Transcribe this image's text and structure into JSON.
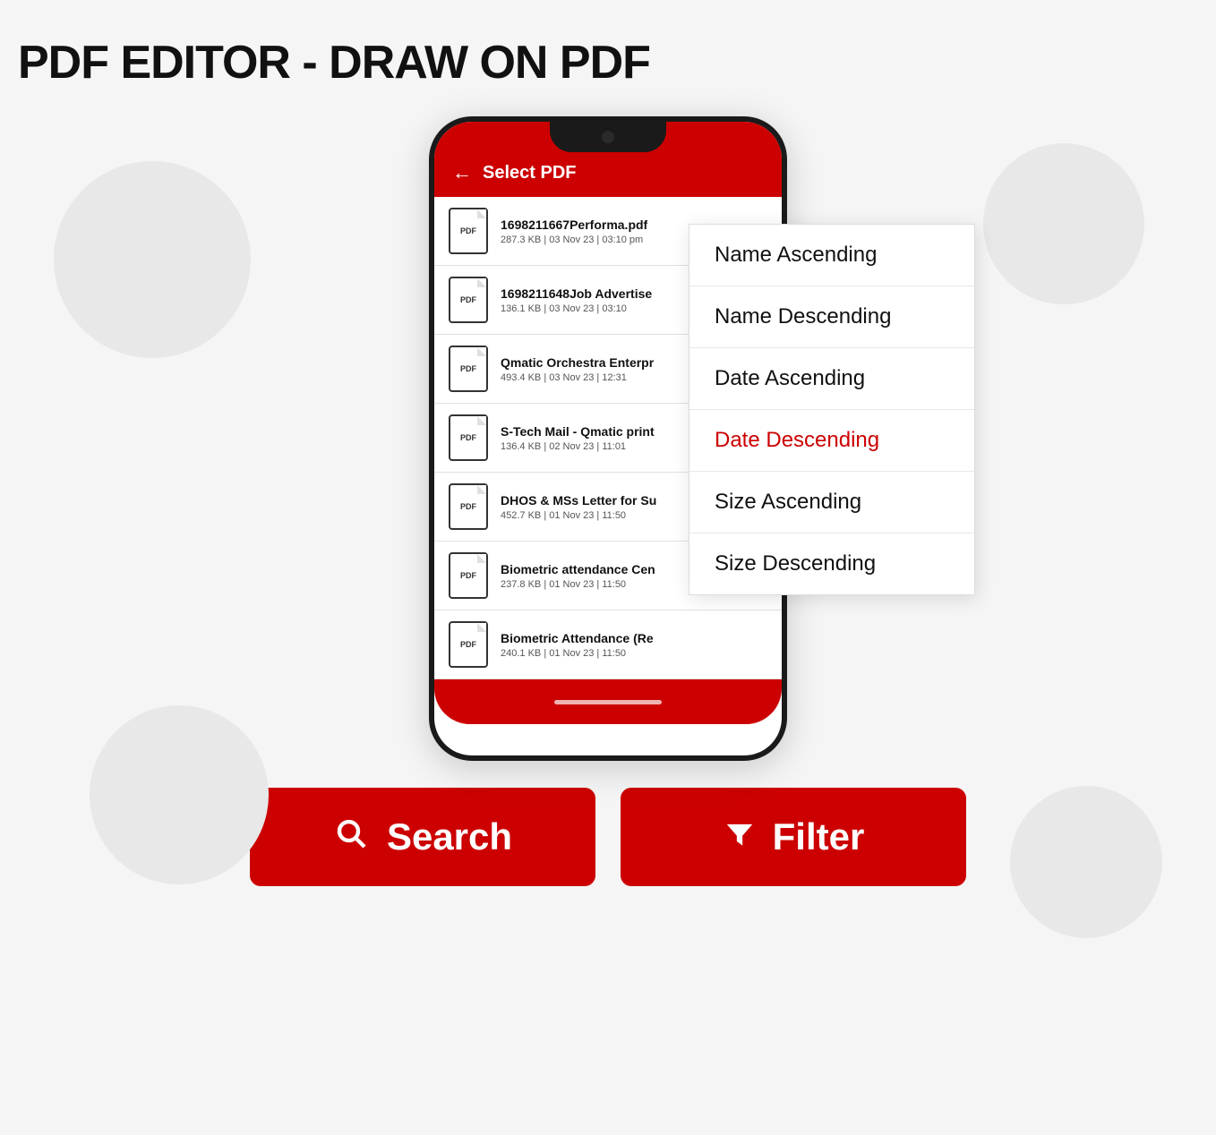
{
  "page": {
    "title": "PDF EDITOR - DRAW ON PDF",
    "bg_color": "#f5f5f5"
  },
  "phone": {
    "header": {
      "back_icon": "←",
      "title": "Select PDF"
    },
    "pdf_list": [
      {
        "name": "1698211667Performa.pdf",
        "meta": "287.3 KB  |  03 Nov 23 | 03:10 pm",
        "icon_label": "PDF"
      },
      {
        "name": "1698211648Job Advertise",
        "meta": "136.1 KB  |  03 Nov 23 | 03:10",
        "icon_label": "PDF"
      },
      {
        "name": "Qmatic Orchestra Enterpr",
        "meta": "493.4 KB  |  03 Nov 23 | 12:31",
        "icon_label": "PDF"
      },
      {
        "name": "S-Tech Mail - Qmatic print",
        "meta": "136.4 KB  |  02 Nov 23 | 11:01",
        "icon_label": "PDF"
      },
      {
        "name": "DHOS & MSs Letter for Su",
        "meta": "452.7 KB  |  01 Nov 23 | 11:50",
        "icon_label": "PDF"
      },
      {
        "name": "Biometric attendance Cen",
        "meta": "237.8 KB  |  01 Nov 23 | 11:50",
        "icon_label": "PDF"
      },
      {
        "name": "Biometric Attendance (Re",
        "meta": "240.1 KB  |  01 Nov 23 | 11:50",
        "icon_label": "PDF"
      }
    ]
  },
  "sort_menu": {
    "items": [
      {
        "label": "Name Ascending",
        "active": false
      },
      {
        "label": "Name Descending",
        "active": false
      },
      {
        "label": "Date Ascending",
        "active": false
      },
      {
        "label": "Date Descending",
        "active": true
      },
      {
        "label": "Size Ascending",
        "active": false
      },
      {
        "label": "Size Descending",
        "active": false
      }
    ]
  },
  "buttons": {
    "search_label": "Search",
    "filter_label": "Filter",
    "search_icon": "🔍",
    "filter_icon": "▼"
  }
}
